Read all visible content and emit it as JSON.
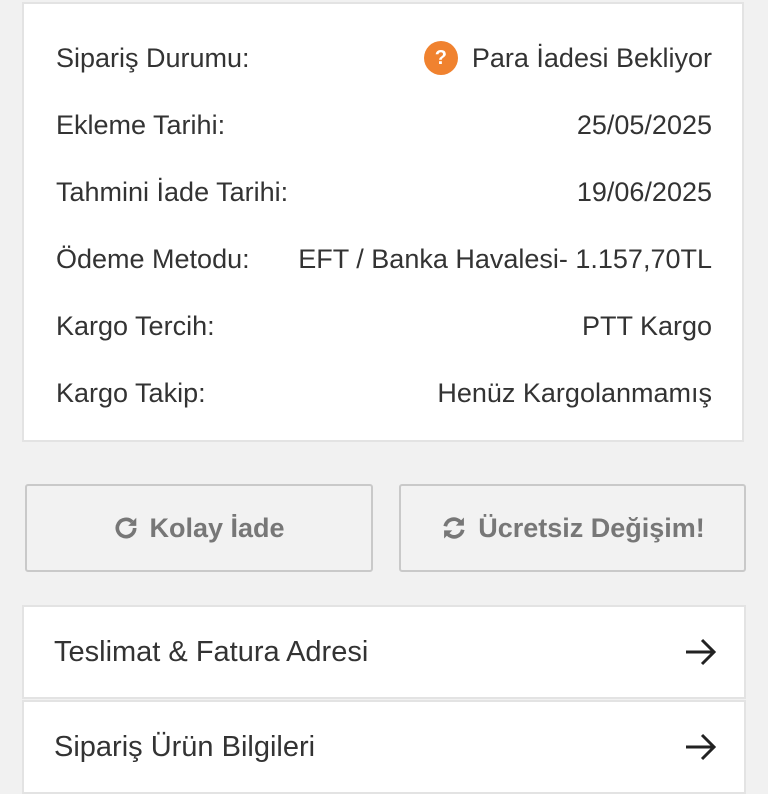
{
  "order_details": {
    "rows": [
      {
        "label": "Sipariş Durumu:",
        "value": "Para İadesi Bekliyor",
        "icon": "question-circle-icon",
        "icon_glyph": "?",
        "icon_color": "#f0822f"
      },
      {
        "label": "Ekleme Tarihi:",
        "value": "25/05/2025"
      },
      {
        "label": "Tahmini İade Tarihi:",
        "value": "19/06/2025"
      },
      {
        "label": "Ödeme Metodu:",
        "value": "EFT / Banka Havalesi- 1.157,70TL"
      },
      {
        "label": "Kargo Tercih:",
        "value": "PTT Kargo"
      },
      {
        "label": "Kargo Takip:",
        "value": "Henüz Kargolanmamış"
      }
    ]
  },
  "actions": {
    "easy_return": {
      "label": "Kolay İade",
      "icon": "refresh-icon"
    },
    "free_exchange": {
      "label": "Ücretsiz Değişim!",
      "icon": "exchange-icon"
    }
  },
  "sections": [
    {
      "label": "Teslimat & Fatura Adresi",
      "icon": "arrow-right-icon"
    },
    {
      "label": "Sipariş Ürün Bilgileri",
      "icon": "arrow-right-icon"
    }
  ],
  "colors": {
    "accent_orange": "#f0822f",
    "page_background": "#f1f1f1",
    "button_text": "#777777"
  }
}
